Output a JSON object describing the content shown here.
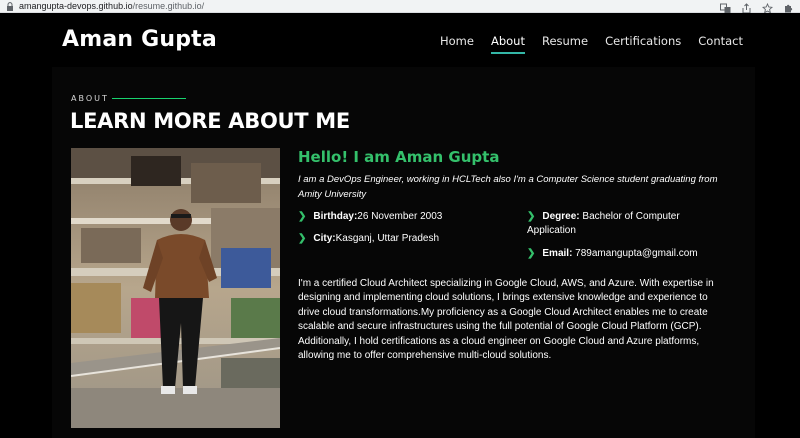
{
  "browser": {
    "url_host": "amangupta-devops.github.io",
    "url_path": "/resume.github.io/"
  },
  "header": {
    "logo": "Aman Gupta",
    "nav": [
      {
        "label": "Home",
        "active": false
      },
      {
        "label": "About",
        "active": true
      },
      {
        "label": "Resume",
        "active": false
      },
      {
        "label": "Certifications",
        "active": false
      },
      {
        "label": "Contact",
        "active": false
      }
    ]
  },
  "about": {
    "section_label": "ABOUT",
    "section_title": "LEARN MORE ABOUT ME",
    "hello": "Hello! I am Aman Gupta",
    "intro": "I am a DevOps Engineer, working in HCLTech also I'm a Computer Science student graduating from Amity University",
    "facts": {
      "birthday_label": "Birthday:",
      "birthday_value": "26 November 2003",
      "city_label": "City:",
      "city_value": "Kasganj, Uttar Pradesh",
      "degree_label": "Degree:",
      "degree_value": " Bachelor of Computer Application",
      "email_label": "Email:",
      "email_value": " 789amangupta@gmail.com"
    },
    "bio": "I'm a certified Cloud Architect specializing in Google Cloud, AWS, and Azure. With expertise in designing and implementing cloud solutions, I brings extensive knowledge and experience to drive cloud transformations.My proficiency as a Google Cloud Architect enables me to create scalable and secure infrastructures using the full potential of Google Cloud Platform (GCP). Additionally, I hold certifications as a cloud engineer on Google Cloud and Azure platforms, allowing me to offer comprehensive multi-cloud solutions."
  },
  "colors": {
    "accent_green": "#34c06b",
    "nav_underline": "#34b7a7",
    "background": "#000000"
  },
  "icons": [
    "lock-icon",
    "translate-icon",
    "share-icon",
    "star-icon",
    "extensions-icon",
    "chevron-right-icon"
  ]
}
